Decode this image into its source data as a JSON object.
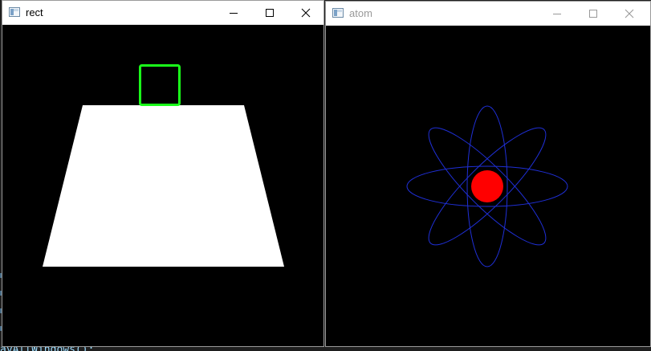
{
  "windows": [
    {
      "id": "rect",
      "title": "rect",
      "active": true,
      "icon": "opencv-window-icon",
      "controls": [
        "minimize-icon",
        "maximize-icon",
        "close-icon"
      ],
      "canvas": {
        "background": "#000000",
        "shapes": [
          {
            "kind": "trapezoid",
            "name": "white-trapezoid",
            "fill": "#ffffff",
            "filled": true
          },
          {
            "kind": "rectangle",
            "name": "green-square-outline",
            "stroke": "#1aff1a",
            "filled": false
          }
        ]
      }
    },
    {
      "id": "atom",
      "title": "atom",
      "active": false,
      "icon": "opencv-window-icon",
      "controls": [
        "minimize-icon",
        "maximize-icon",
        "close-icon"
      ],
      "canvas": {
        "background": "#000000",
        "shapes": [
          {
            "kind": "ellipse",
            "name": "orbit-horizontal",
            "stroke": "#1f2fd6",
            "angle_deg": 0
          },
          {
            "kind": "ellipse",
            "name": "orbit-vertical",
            "stroke": "#1f2fd6",
            "angle_deg": 90
          },
          {
            "kind": "ellipse",
            "name": "orbit-diagonal-45",
            "stroke": "#1f2fd6",
            "angle_deg": 45
          },
          {
            "kind": "ellipse",
            "name": "orbit-diagonal-135",
            "stroke": "#1f2fd6",
            "angle_deg": 135
          },
          {
            "kind": "circle",
            "name": "nucleus",
            "fill": "#ff0000",
            "filled": true
          }
        ]
      }
    }
  ],
  "background": {
    "code_fragment": "ayAllWindows();",
    "edge_glyph": "x"
  }
}
